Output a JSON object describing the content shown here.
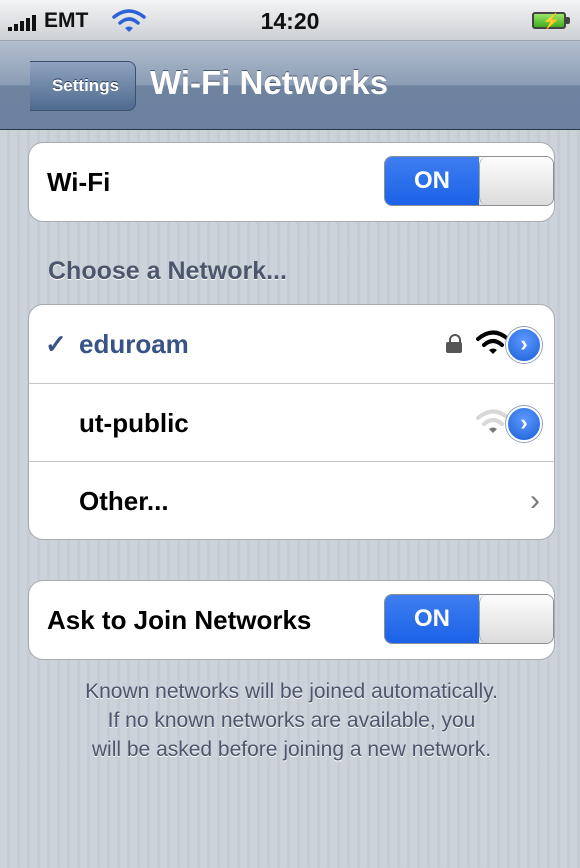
{
  "status_bar": {
    "carrier": "EMT",
    "time": "14:20",
    "icons": [
      "signal-icon",
      "wifi-icon",
      "battery-charging-icon"
    ]
  },
  "nav": {
    "back_label": "Settings",
    "title": "Wi-Fi Networks"
  },
  "wifi_toggle": {
    "label": "Wi-Fi",
    "state": "ON"
  },
  "networks_section": {
    "title": "Choose a Network...",
    "networks": [
      {
        "name": "eduroam",
        "selected": true,
        "secured": true,
        "signal": "full"
      },
      {
        "name": "ut-public",
        "selected": false,
        "secured": false,
        "signal": "weak"
      }
    ],
    "other_label": "Other..."
  },
  "ask_join": {
    "label": "Ask to Join Networks",
    "state": "ON"
  },
  "footer": {
    "line1": "Known networks will be joined automatically.",
    "line2": "If no known networks are available, you",
    "line3": "will be asked before joining a new network."
  },
  "colors": {
    "accent_blue": "#1b62e8",
    "selected_text": "#385487",
    "section_text": "#4c566c",
    "background": "#c5ccd4"
  }
}
